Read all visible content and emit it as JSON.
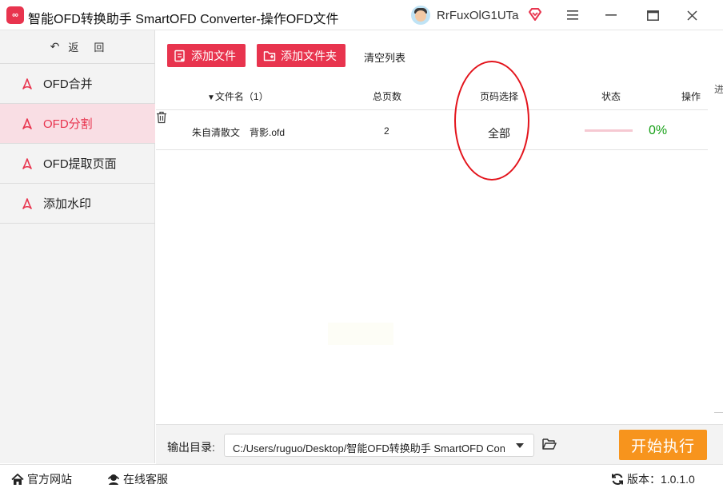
{
  "titlebar": {
    "app_logo_text": "∞",
    "title": "智能OFD转换助手 SmartOFD Converter-操作OFD文件",
    "user_name": "RrFuxOlG1UTa"
  },
  "sidebar": {
    "back_label_1": "返",
    "back_label_2": "回",
    "items": [
      {
        "label": "OFD合并",
        "active": false
      },
      {
        "label": "OFD分割",
        "active": true
      },
      {
        "label": "OFD提取页面",
        "active": false
      },
      {
        "label": "添加水印",
        "active": false
      }
    ]
  },
  "toolbar": {
    "add_file_label": "添加文件",
    "add_folder_label": "添加文件夹",
    "clear_label": "清空列表"
  },
  "table": {
    "headers": {
      "name": "文件名（1）",
      "pages": "总页数",
      "range": "页码选择",
      "status": "状态",
      "op": "操作"
    },
    "rows": [
      {
        "name": "朱自清散文　背影.ofd",
        "pages": "2",
        "range": "全部",
        "progress": 0,
        "percent": "0%"
      }
    ]
  },
  "edge_text": "进",
  "output": {
    "label": "输出目录:",
    "path": "C:/Users/ruguo/Desktop/智能OFD转换助手 SmartOFD Converter",
    "start_label": "开始执行"
  },
  "footer": {
    "site_label": "官方网站",
    "service_label": "在线客服",
    "version_label": "版本：1.0.1.0"
  },
  "colors": {
    "accent": "#e8344e",
    "start_button": "#f7941d",
    "progress_text": "#17a017",
    "annotation": "#e3141c"
  }
}
